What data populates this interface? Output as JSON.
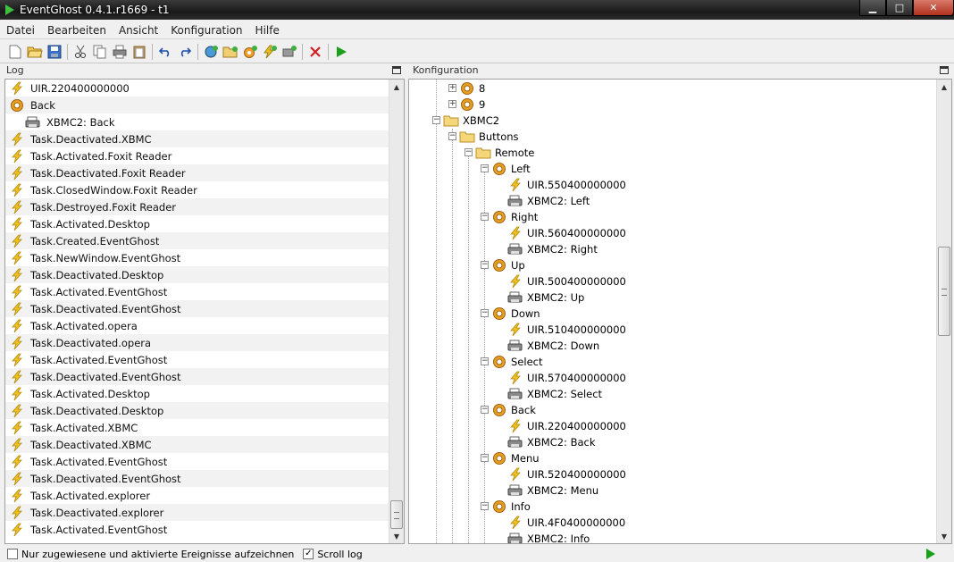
{
  "window": {
    "title": "EventGhost 0.4.1.r1669 - t1",
    "minimize": "▁",
    "maximize": "□",
    "close": "✕"
  },
  "menu": [
    "Datei",
    "Bearbeiten",
    "Ansicht",
    "Konfiguration",
    "Hilfe"
  ],
  "toolbar": {
    "icons": [
      "new-file-icon",
      "open-folder-icon",
      "save-icon",
      "cut-icon",
      "copy-icon",
      "print-icon",
      "paste-icon",
      "undo-icon",
      "redo-icon",
      "add-plugin-icon",
      "add-folder-icon",
      "add-macro-icon",
      "add-event-icon",
      "add-action-icon",
      "delete-icon",
      "execute-icon"
    ]
  },
  "log": {
    "header": "Log",
    "rows": [
      {
        "icon": "event",
        "text": "UIR.220400000000",
        "indent": 0
      },
      {
        "icon": "macro",
        "text": "Back",
        "indent": 0
      },
      {
        "icon": "action",
        "text": "XBMC2: Back",
        "indent": 1
      },
      {
        "icon": "event",
        "text": "Task.Deactivated.XBMC",
        "indent": 0
      },
      {
        "icon": "event",
        "text": "Task.Activated.Foxit Reader",
        "indent": 0
      },
      {
        "icon": "event",
        "text": "Task.Deactivated.Foxit Reader",
        "indent": 0
      },
      {
        "icon": "event",
        "text": "Task.ClosedWindow.Foxit Reader",
        "indent": 0
      },
      {
        "icon": "event",
        "text": "Task.Destroyed.Foxit Reader",
        "indent": 0
      },
      {
        "icon": "event",
        "text": "Task.Activated.Desktop",
        "indent": 0
      },
      {
        "icon": "event",
        "text": "Task.Created.EventGhost",
        "indent": 0
      },
      {
        "icon": "event",
        "text": "Task.NewWindow.EventGhost",
        "indent": 0
      },
      {
        "icon": "event",
        "text": "Task.Deactivated.Desktop",
        "indent": 0
      },
      {
        "icon": "event",
        "text": "Task.Activated.EventGhost",
        "indent": 0
      },
      {
        "icon": "event",
        "text": "Task.Deactivated.EventGhost",
        "indent": 0
      },
      {
        "icon": "event",
        "text": "Task.Activated.opera",
        "indent": 0
      },
      {
        "icon": "event",
        "text": "Task.Deactivated.opera",
        "indent": 0
      },
      {
        "icon": "event",
        "text": "Task.Activated.EventGhost",
        "indent": 0
      },
      {
        "icon": "event",
        "text": "Task.Deactivated.EventGhost",
        "indent": 0
      },
      {
        "icon": "event",
        "text": "Task.Activated.Desktop",
        "indent": 0
      },
      {
        "icon": "event",
        "text": "Task.Deactivated.Desktop",
        "indent": 0
      },
      {
        "icon": "event",
        "text": "Task.Activated.XBMC",
        "indent": 0
      },
      {
        "icon": "event",
        "text": "Task.Deactivated.XBMC",
        "indent": 0
      },
      {
        "icon": "event",
        "text": "Task.Activated.EventGhost",
        "indent": 0
      },
      {
        "icon": "event",
        "text": "Task.Deactivated.EventGhost",
        "indent": 0
      },
      {
        "icon": "event",
        "text": "Task.Activated.explorer",
        "indent": 0
      },
      {
        "icon": "event",
        "text": "Task.Deactivated.explorer",
        "indent": 0
      },
      {
        "icon": "event",
        "text": "Task.Activated.EventGhost",
        "indent": 0
      }
    ]
  },
  "config": {
    "header": "Konfiguration",
    "nodes": [
      {
        "icon": "macro",
        "text": "8",
        "level": 1,
        "expander": "+"
      },
      {
        "icon": "macro",
        "text": "9",
        "level": 1,
        "expander": "+"
      },
      {
        "icon": "folder",
        "text": "XBMC2",
        "level": 0,
        "expander": "−"
      },
      {
        "icon": "folder",
        "text": "Buttons",
        "level": 1,
        "expander": "−"
      },
      {
        "icon": "folder",
        "text": "Remote",
        "level": 2,
        "expander": "−"
      },
      {
        "icon": "macro",
        "text": "Left",
        "level": 3,
        "expander": "−"
      },
      {
        "icon": "event",
        "text": "UIR.550400000000",
        "level": 4,
        "expander": ""
      },
      {
        "icon": "action",
        "text": "XBMC2: Left",
        "level": 4,
        "expander": ""
      },
      {
        "icon": "macro",
        "text": "Right",
        "level": 3,
        "expander": "−"
      },
      {
        "icon": "event",
        "text": "UIR.560400000000",
        "level": 4,
        "expander": ""
      },
      {
        "icon": "action",
        "text": "XBMC2: Right",
        "level": 4,
        "expander": ""
      },
      {
        "icon": "macro",
        "text": "Up",
        "level": 3,
        "expander": "−"
      },
      {
        "icon": "event",
        "text": "UIR.500400000000",
        "level": 4,
        "expander": ""
      },
      {
        "icon": "action",
        "text": "XBMC2: Up",
        "level": 4,
        "expander": ""
      },
      {
        "icon": "macro",
        "text": "Down",
        "level": 3,
        "expander": "−"
      },
      {
        "icon": "event",
        "text": "UIR.510400000000",
        "level": 4,
        "expander": ""
      },
      {
        "icon": "action",
        "text": "XBMC2: Down",
        "level": 4,
        "expander": ""
      },
      {
        "icon": "macro",
        "text": "Select",
        "level": 3,
        "expander": "−"
      },
      {
        "icon": "event",
        "text": "UIR.570400000000",
        "level": 4,
        "expander": ""
      },
      {
        "icon": "action",
        "text": "XBMC2: Select",
        "level": 4,
        "expander": ""
      },
      {
        "icon": "macro",
        "text": "Back",
        "level": 3,
        "expander": "−"
      },
      {
        "icon": "event",
        "text": "UIR.220400000000",
        "level": 4,
        "expander": ""
      },
      {
        "icon": "action",
        "text": "XBMC2: Back",
        "level": 4,
        "expander": ""
      },
      {
        "icon": "macro",
        "text": "Menu",
        "level": 3,
        "expander": "−"
      },
      {
        "icon": "event",
        "text": "UIR.520400000000",
        "level": 4,
        "expander": ""
      },
      {
        "icon": "action",
        "text": "XBMC2: Menu",
        "level": 4,
        "expander": ""
      },
      {
        "icon": "macro",
        "text": "Info",
        "level": 3,
        "expander": "−"
      },
      {
        "icon": "event",
        "text": "UIR.4F0400000000",
        "level": 4,
        "expander": ""
      },
      {
        "icon": "action",
        "text": "XBMC2: Info",
        "level": 4,
        "expander": ""
      }
    ]
  },
  "status": {
    "only_assigned_label": "Nur zugewiesene und aktivierte Ereignisse aufzeichnen",
    "only_assigned_checked": false,
    "scroll_log_label": "Scroll log",
    "scroll_log_checked": true
  },
  "colors": {
    "event": "#f0c020",
    "macro": "#e8a020",
    "folder": "#f5d77a",
    "action": "#8a8a8a",
    "run": "#1aa01a",
    "delete": "#d42020"
  }
}
